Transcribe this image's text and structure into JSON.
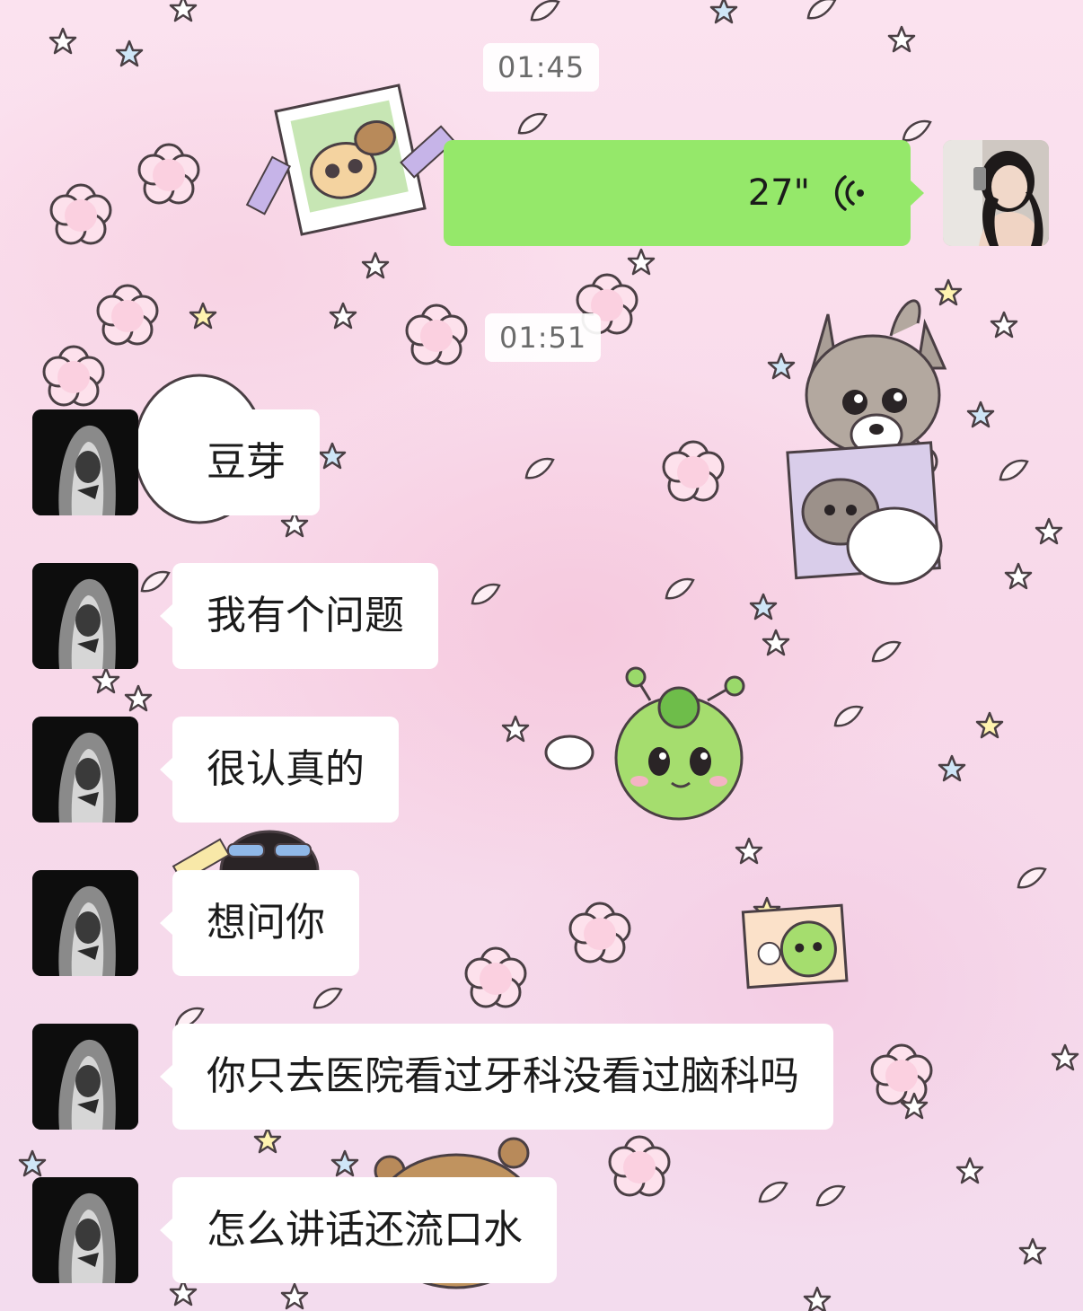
{
  "timestamps": [
    "01:45",
    "01:51"
  ],
  "voice_message": {
    "duration": "27\"",
    "icon": "voice-wave-icon",
    "bubble_color": "#95e86a"
  },
  "messages": [
    {
      "text": "豆芽"
    },
    {
      "text": "我有个问题"
    },
    {
      "text": "很认真的"
    },
    {
      "text": "想问你"
    },
    {
      "text": "你只去医院看过牙科没看过脑科吗"
    },
    {
      "text": "怎么讲话还流口水"
    }
  ],
  "colors": {
    "incoming_bubble": "#ffffff",
    "outgoing_bubble": "#95e86a",
    "timestamp_text": "#6b6b6b"
  }
}
